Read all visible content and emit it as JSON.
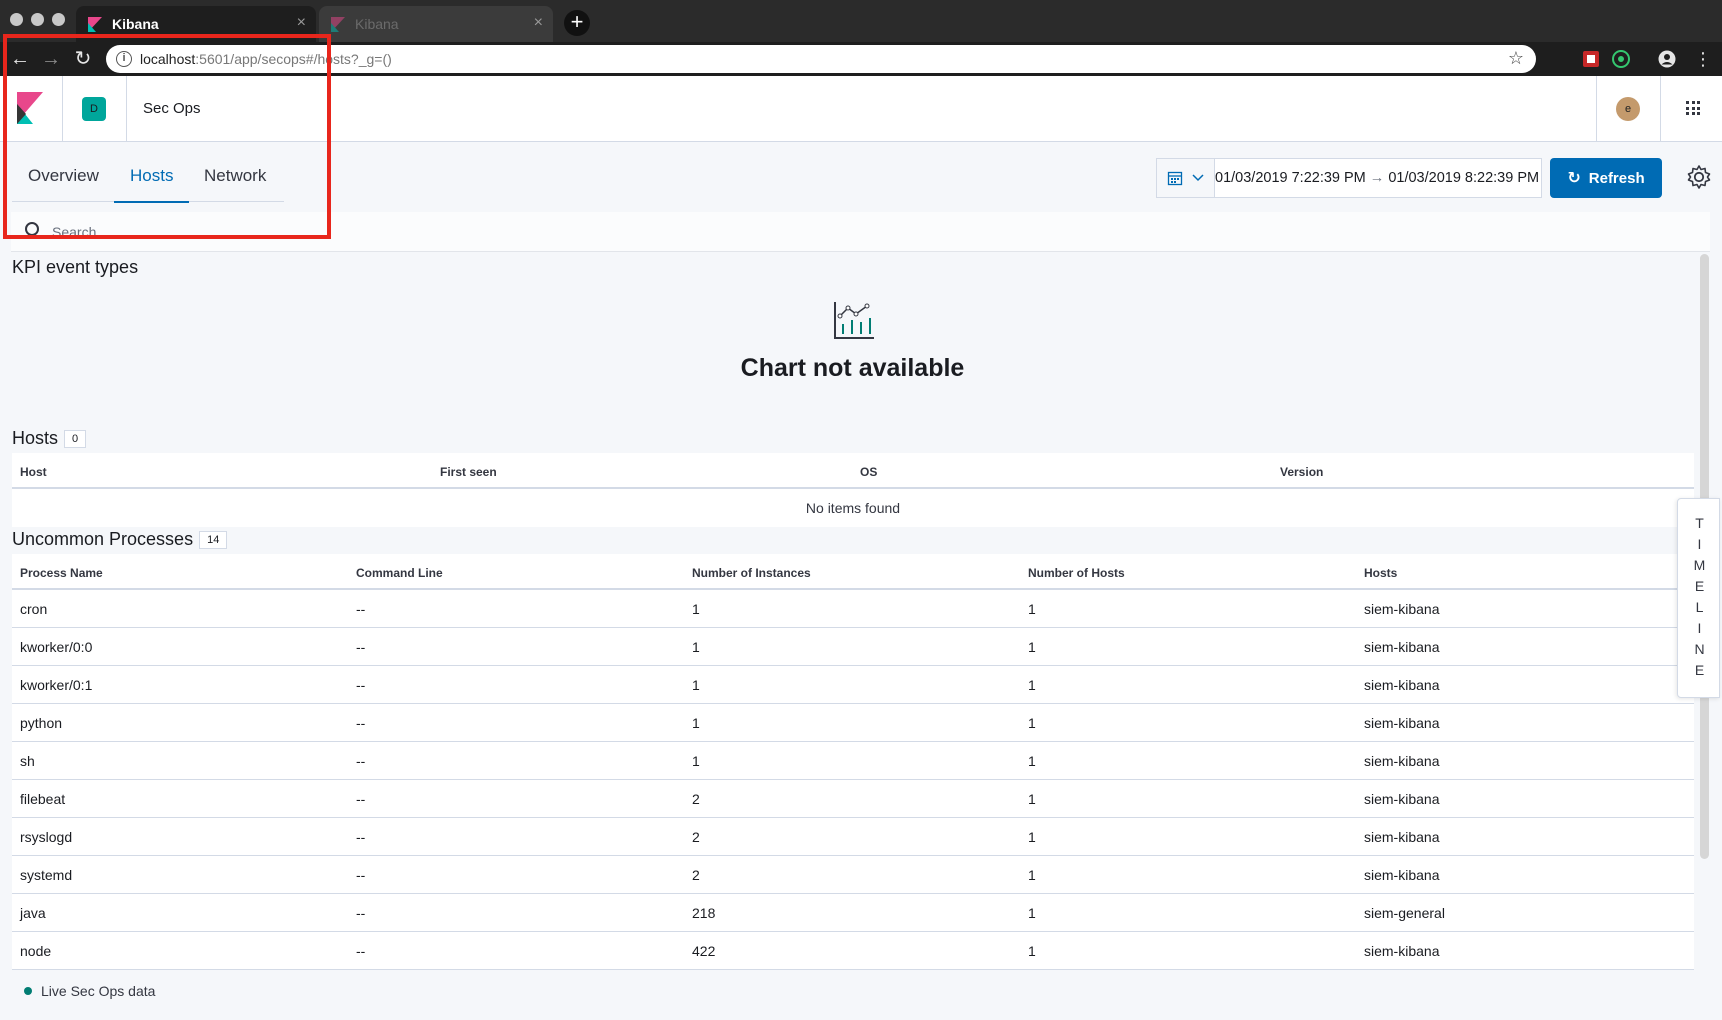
{
  "browser": {
    "tabs": [
      {
        "label": "Kibana",
        "active": true
      },
      {
        "label": "Kibana",
        "active": false
      }
    ],
    "url_host": "localhost",
    "url_rest": ":5601/app/secops#/hosts?_g=()"
  },
  "header": {
    "space_initial": "D",
    "app_name": "Sec Ops",
    "avatar_initial": "e"
  },
  "nav": {
    "tabs": [
      "Overview",
      "Hosts",
      "Network"
    ],
    "active_tab": "Hosts"
  },
  "datepicker": {
    "start": "01/03/2019 7:22:39 PM",
    "arrow": "→",
    "end": "01/03/2019 8:22:39 PM"
  },
  "refresh_label": "Refresh",
  "search": {
    "placeholder": "Search"
  },
  "kpi": {
    "title": "KPI event types",
    "empty_message": "Chart not available"
  },
  "hosts": {
    "title": "Hosts",
    "count": "0",
    "columns": [
      "Host",
      "First seen",
      "OS",
      "Version"
    ],
    "empty_message": "No items found"
  },
  "processes": {
    "title": "Uncommon Processes",
    "count": "14",
    "columns": [
      "Process Name",
      "Command Line",
      "Number of Instances",
      "Number of Hosts",
      "Hosts"
    ],
    "rows": [
      [
        "cron",
        "--",
        "1",
        "1",
        "siem-kibana"
      ],
      [
        "kworker/0:0",
        "--",
        "1",
        "1",
        "siem-kibana"
      ],
      [
        "kworker/0:1",
        "--",
        "1",
        "1",
        "siem-kibana"
      ],
      [
        "python",
        "--",
        "1",
        "1",
        "siem-kibana"
      ],
      [
        "sh",
        "--",
        "1",
        "1",
        "siem-kibana"
      ],
      [
        "filebeat",
        "--",
        "2",
        "1",
        "siem-kibana"
      ],
      [
        "rsyslogd",
        "--",
        "2",
        "1",
        "siem-kibana"
      ],
      [
        "systemd",
        "--",
        "2",
        "1",
        "siem-kibana"
      ],
      [
        "java",
        "--",
        "218",
        "1",
        "siem-general"
      ],
      [
        "node",
        "--",
        "422",
        "1",
        "siem-kibana"
      ]
    ]
  },
  "timeline_label": "TIMELINE",
  "footer_status": "Live Sec Ops data",
  "colors": {
    "accent": "#006bb4",
    "highlight_box": "#e8261c",
    "space_badge": "#00a69b",
    "status_dot": "#017d73"
  }
}
